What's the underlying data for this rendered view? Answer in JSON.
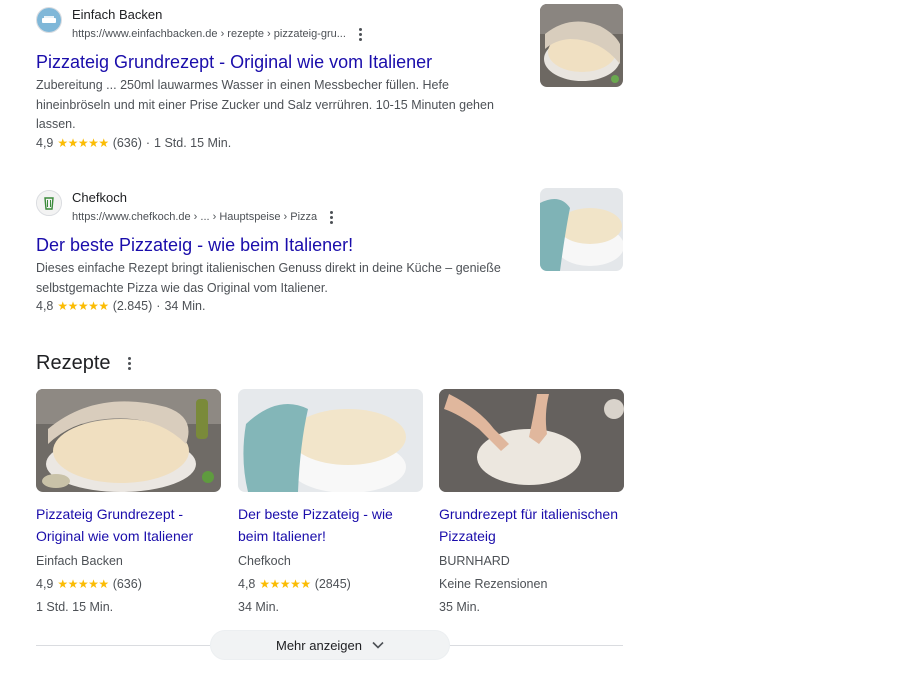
{
  "results": [
    {
      "site_name": "Einfach Backen",
      "url": "https://www.einfachbacken.de › rezepte › pizzateig-gru...",
      "title": "Pizzateig Grundrezept - Original wie vom Italiener",
      "snippet": "Zubereitung ... 250ml lauwarmes Wasser in einen Messbecher füllen. Hefe hineinbröseln und mit einer Prise Zucker und Salz verrühren. 10-15 Minuten gehen lassen.",
      "rating": "4,9",
      "stars": "★★★★★",
      "reviews": "(636)",
      "sep": "·",
      "time": "1 Std. 15 Min.",
      "favicon": "einfach-backen-logo",
      "thumbnail": "pizza-dough-under-cloth"
    },
    {
      "site_name": "Chefkoch",
      "url": "https://www.chefkoch.de › ... › Hauptspeise › Pizza",
      "title": "Der beste Pizzateig - wie beim Italiener!",
      "snippet": "Dieses einfache Rezept bringt italienischen Genuss direkt in deine Küche – genieße selbstgemachte Pizza wie das Original vom Italiener.",
      "rating": "4,8",
      "stars": "★★★★★",
      "reviews": "(2.845)",
      "sep": "·",
      "time": "34 Min.",
      "favicon": "chefkoch-logo",
      "thumbnail": "pizza-dough-in-bowl-teal-cloth"
    }
  ],
  "recipes": {
    "heading": "Rezepte",
    "cards": [
      {
        "title": "Pizzateig Grundrezept - Original wie vom Italiener",
        "source": "Einfach Backen",
        "rating": "4,9",
        "stars": "★★★★★",
        "reviews": "(636)",
        "time": "1 Std. 15 Min.",
        "image": "pizza-dough-under-cloth"
      },
      {
        "title": "Der beste Pizzateig - wie beim Italiener!",
        "source": "Chefkoch",
        "rating": "4,8",
        "stars": "★★★★★",
        "reviews": "(2845)",
        "time": "34 Min.",
        "image": "pizza-dough-in-bowl-teal-cloth"
      },
      {
        "title": "Grundrezept für italienischen Pizzateig",
        "source": "BURNHARD",
        "no_reviews": "Keine Rezensionen",
        "time": "35 Min.",
        "image": "hands-stretching-pizza-dough"
      }
    ],
    "more_label": "Mehr anzeigen"
  },
  "colors": {
    "link": "#1a0dab",
    "star": "#fbbc04",
    "muted": "#4d5156"
  }
}
